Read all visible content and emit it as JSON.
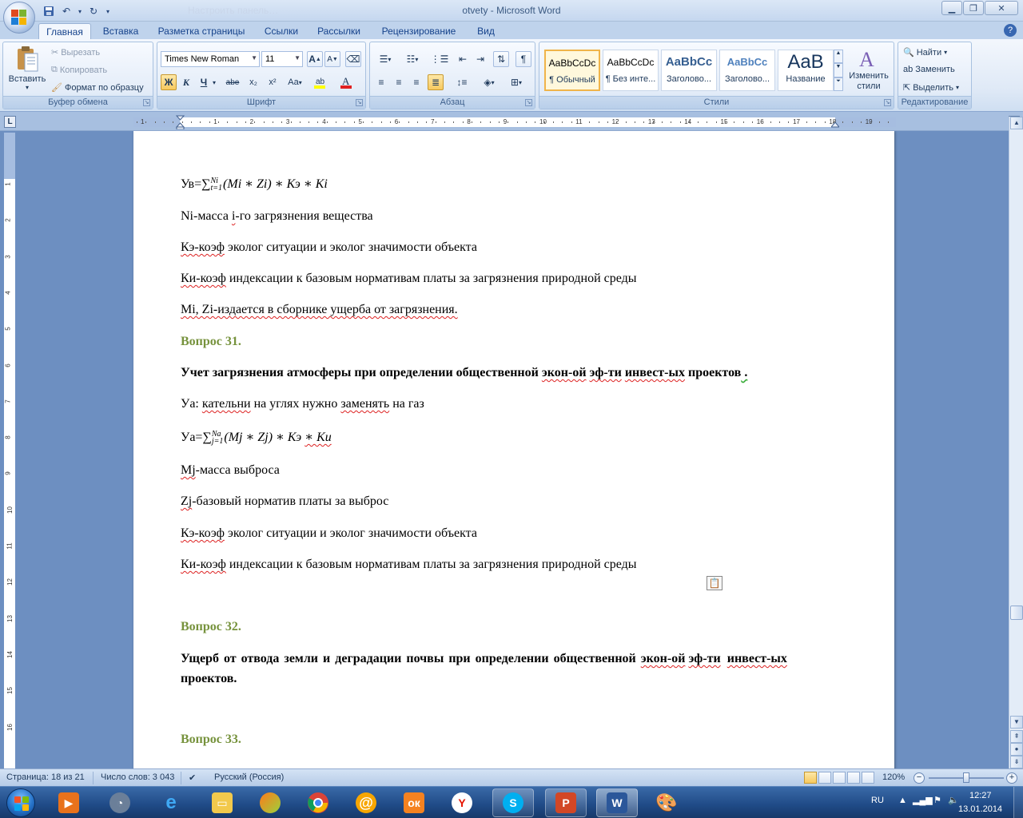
{
  "window": {
    "title": "otvety - Microsoft Word",
    "ghost_title": "Настроить панель…"
  },
  "tabs": [
    "Главная",
    "Вставка",
    "Разметка страницы",
    "Ссылки",
    "Рассылки",
    "Рецензирование",
    "Вид"
  ],
  "ribbon": {
    "clipboard": {
      "label": "Буфер обмена",
      "paste": "Вставить",
      "cut": "Вырезать",
      "copy": "Копировать",
      "format_painter": "Формат по образцу"
    },
    "font": {
      "label": "Шрифт",
      "font_name": "Times New Roman",
      "font_size": "11",
      "bold": "Ж",
      "italic": "К",
      "underline": "Ч",
      "strike": "abe",
      "subscript": "x₂",
      "superscript": "x²",
      "change_case": "Аа",
      "grow": "A",
      "shrink": "A"
    },
    "paragraph": {
      "label": "Абзац"
    },
    "styles": {
      "label": "Стили",
      "cards": [
        {
          "sample": "AaBbCcDc",
          "name": "¶ Обычный"
        },
        {
          "sample": "AaBbCcDc",
          "name": "¶ Без инте..."
        },
        {
          "sample": "AaBbCc",
          "name": "Заголово..."
        },
        {
          "sample": "AaBbCc",
          "name": "Заголово..."
        },
        {
          "sample": "AaB",
          "name": "Название"
        }
      ],
      "change_styles": "Изменить стили"
    },
    "editing": {
      "label": "Редактирование",
      "find": "Найти",
      "replace": "Заменить",
      "select": "Выделить"
    }
  },
  "ruler": {
    "numbers": [
      "1",
      "1",
      "2",
      "3",
      "4",
      "5",
      "6",
      "7",
      "8",
      "9",
      "10",
      "11",
      "12",
      "13",
      "14",
      "15",
      "16",
      "17",
      "18",
      "19"
    ]
  },
  "vruler": {
    "numbers": [
      "1",
      "2",
      "3",
      "4",
      "5",
      "6",
      "7",
      "8",
      "9",
      "10",
      "11",
      "12",
      "13",
      "14",
      "15",
      "16"
    ]
  },
  "document": {
    "formula1": {
      "lhs": "Ув=",
      "sum": "∑",
      "sub": "t=1",
      "sup": "Ni",
      "body": "(Mi ∗ Zi) ∗ Кэ ∗ Кi"
    },
    "p1_a": "Ni-масса ",
    "p1_b": "i",
    "p1_c": "-го загрязнения вещества",
    "p2_a": "Кэ-коэф",
    "p2_b": " эколог ситуации и эколог значимости объекта",
    "p3_a": "Ки-коэф",
    "p3_b": " индексации к базовым нормативам платы за загрязнения природной среды",
    "p4": "Mi, Zi-издается в сборнике ущерба от загрязнения.",
    "h31": "Вопрос 31.",
    "p5_a": "Учет загрязнения атмосферы при определении общественной ",
    "p5_b": "экон-ой",
    "p5_c": " ",
    "p5_d": "эф-ти",
    "p5_e": " ",
    "p5_f": "инвест-ых",
    "p5_g": " проектов",
    "p5_h": " .",
    "p6_a": "Уа: ",
    "p6_b": "кательни",
    "p6_c": " на углях нужно ",
    "p6_d": "заменять",
    "p6_e": " на газ",
    "formula2": {
      "lhs": "Уа=",
      "sum": "∑",
      "sub": "j=1",
      "sup": "Na",
      "body1": "(Mj ∗ Zj) ∗ Кэ ",
      "body2": "∗ Ки"
    },
    "p7_a": "Mj",
    "p7_b": "-масса выброса",
    "p8_a": "Zj",
    "p8_b": "-базовый норматив платы за выброс",
    "p9_a": "Кэ-коэф",
    "p9_b": " эколог ситуации и эколог значимости объекта",
    "p10_a": "Ки-коэф",
    "p10_b": " индексации к базовым нормативам платы за загрязнения природной среды",
    "h32": "Вопрос 32.",
    "p11_a": "Ущерб от отвода земли и деградации почвы при определении общественной ",
    "p11_b": "экон-ой",
    "p11_c": " ",
    "p11_d": "эф-ти",
    "p11_e": "  ",
    "p11_f": "инвест-ых",
    "p11_line2": "проектов.",
    "h33": "Вопрос 33."
  },
  "status": {
    "page": "Страница: 18 из 21",
    "words": "Число слов: 3 043",
    "language": "Русский (Россия)",
    "zoom": "120%"
  },
  "tray": {
    "lang": "RU",
    "time": "12:27",
    "date": "13.01.2014"
  }
}
